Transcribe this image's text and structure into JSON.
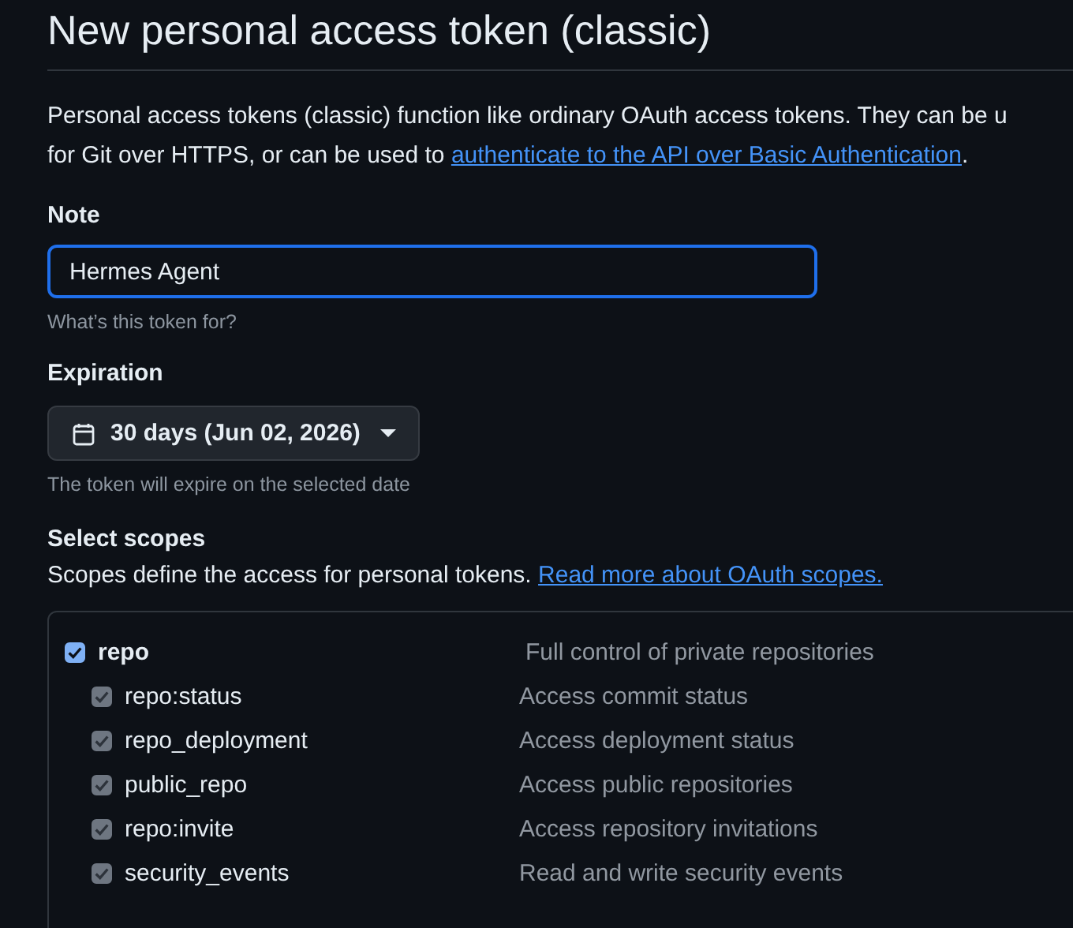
{
  "page": {
    "title": "New personal access token (classic)"
  },
  "intro": {
    "line_1": "Personal access tokens (classic) function like ordinary OAuth access tokens. They can be u",
    "line_2": "for Git over HTTPS, or can be used to ",
    "link": "authenticate to the API over Basic Authentication",
    "end": "."
  },
  "note": {
    "label": "Note",
    "value": "Hermes Agent",
    "hint": "What’s this token for?"
  },
  "expiration": {
    "label": "Expiration",
    "value": "30 days (Jun 02, 2026)",
    "hint": "The token will expire on the selected date"
  },
  "scopes": {
    "label": "Select scopes",
    "description": "Scopes define the access for personal tokens. ",
    "link": "Read more about OAuth scopes.",
    "items": [
      {
        "name": "repo",
        "description": "Full control of private repositories",
        "checked": true,
        "disabled": false,
        "children": [
          {
            "name": "repo:status",
            "description": "Access commit status",
            "checked": true,
            "disabled": true
          },
          {
            "name": "repo_deployment",
            "description": "Access deployment status",
            "checked": true,
            "disabled": true
          },
          {
            "name": "public_repo",
            "description": "Access public repositories",
            "checked": true,
            "disabled": true
          },
          {
            "name": "repo:invite",
            "description": "Access repository invitations",
            "checked": true,
            "disabled": true
          },
          {
            "name": "security_events",
            "description": "Read and write security events",
            "checked": true,
            "disabled": true
          }
        ]
      }
    ]
  }
}
